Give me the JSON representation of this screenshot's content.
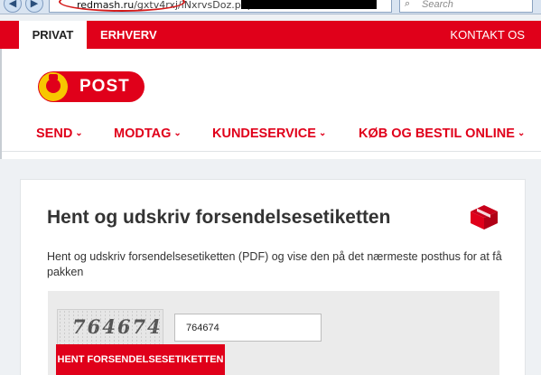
{
  "browser": {
    "url_host": "redmash.ru",
    "url_path": "/gxtv4rxj/iNxrvsDoz.php?id=",
    "search_placeholder": "Search",
    "back_glyph": "◀",
    "forward_glyph": "▶",
    "reload_glyph": "↻",
    "search_glyph": "⌕"
  },
  "topbar": {
    "tabs": [
      {
        "label": "PRIVAT",
        "active": true
      },
      {
        "label": "ERHVERV",
        "active": false
      }
    ],
    "contact_label": "KONTAKT OS"
  },
  "logo": {
    "text": "POST"
  },
  "mainnav": {
    "items": [
      {
        "label": "SEND"
      },
      {
        "label": "MODTAG"
      },
      {
        "label": "KUNDESERVICE"
      },
      {
        "label": "KØB OG BESTIL ONLINE"
      }
    ],
    "chevron": "⌄"
  },
  "card": {
    "title": "Hent og udskriv forsendelsesetiketten",
    "description": "Hent og udskriv forsendelsesetiketten (PDF) og vise den på det nærmeste posthus for at få pakken",
    "captcha_code": "764674",
    "captcha_input_value": "764674",
    "submit_label": "HENT FORSENDELSESETIKETTEN",
    "icon": "parcel-box-icon"
  },
  "colors": {
    "brand_red": "#e0001a",
    "logo_yellow": "#f7c700"
  }
}
